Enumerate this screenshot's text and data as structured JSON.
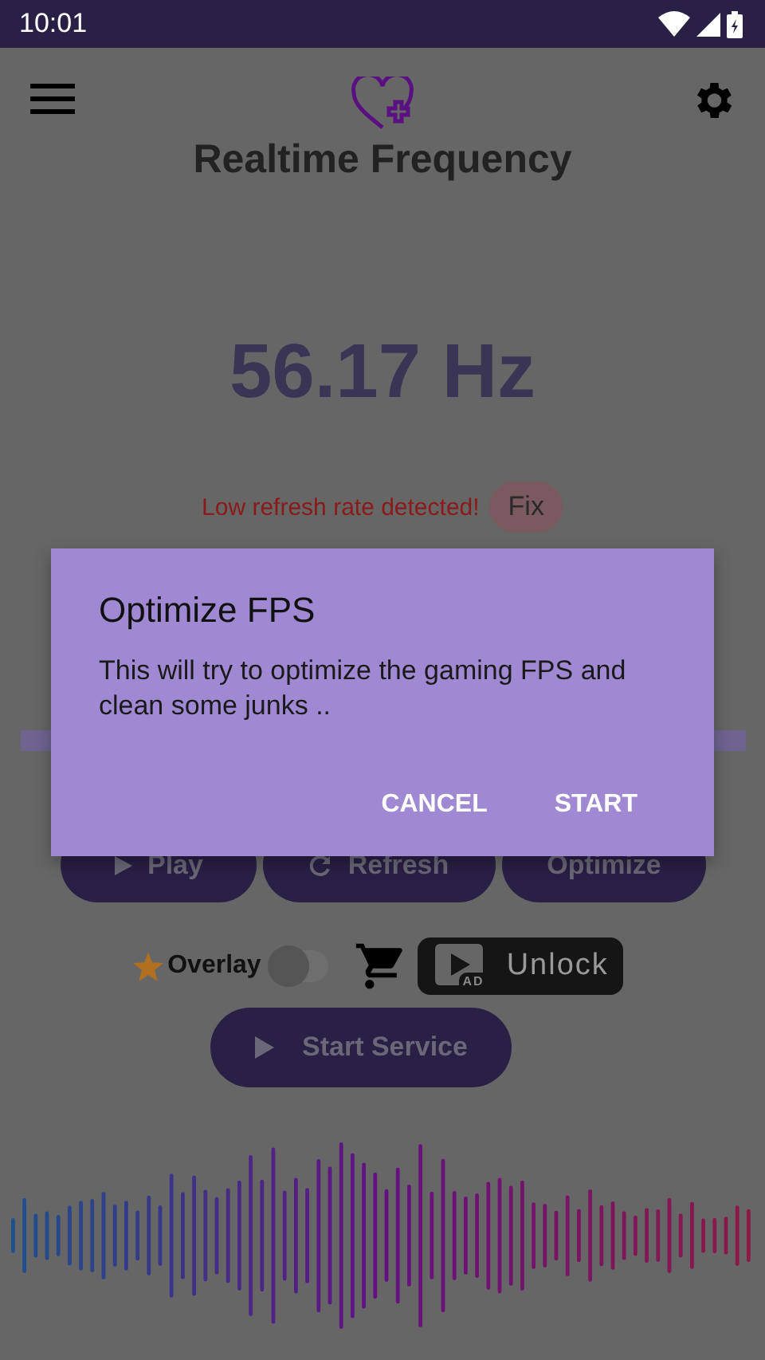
{
  "status_bar": {
    "time": "10:01"
  },
  "header": {
    "title": "Realtime Frequency"
  },
  "frequency": {
    "reading": "56.17 Hz"
  },
  "warning": {
    "message": "Low refresh rate detected!",
    "fix_button": "Fix"
  },
  "progress": {
    "level": 1
  },
  "actions": [
    {
      "label": "Play",
      "kind": "play"
    },
    {
      "label": "Refresh",
      "kind": "refresh"
    },
    {
      "label": "Optimize",
      "kind": "plain"
    }
  ],
  "overlay": {
    "label": "Overlay",
    "on": false
  },
  "unlock_button": {
    "label": "Unlock",
    "badge": "AD"
  },
  "start_button": {
    "label": "Start Service"
  },
  "dialog": {
    "title": "Optimize FPS",
    "message": "This will try to optimize the gaming FPS and clean some junks ..",
    "buttons": [
      "CANCEL",
      "START"
    ]
  }
}
